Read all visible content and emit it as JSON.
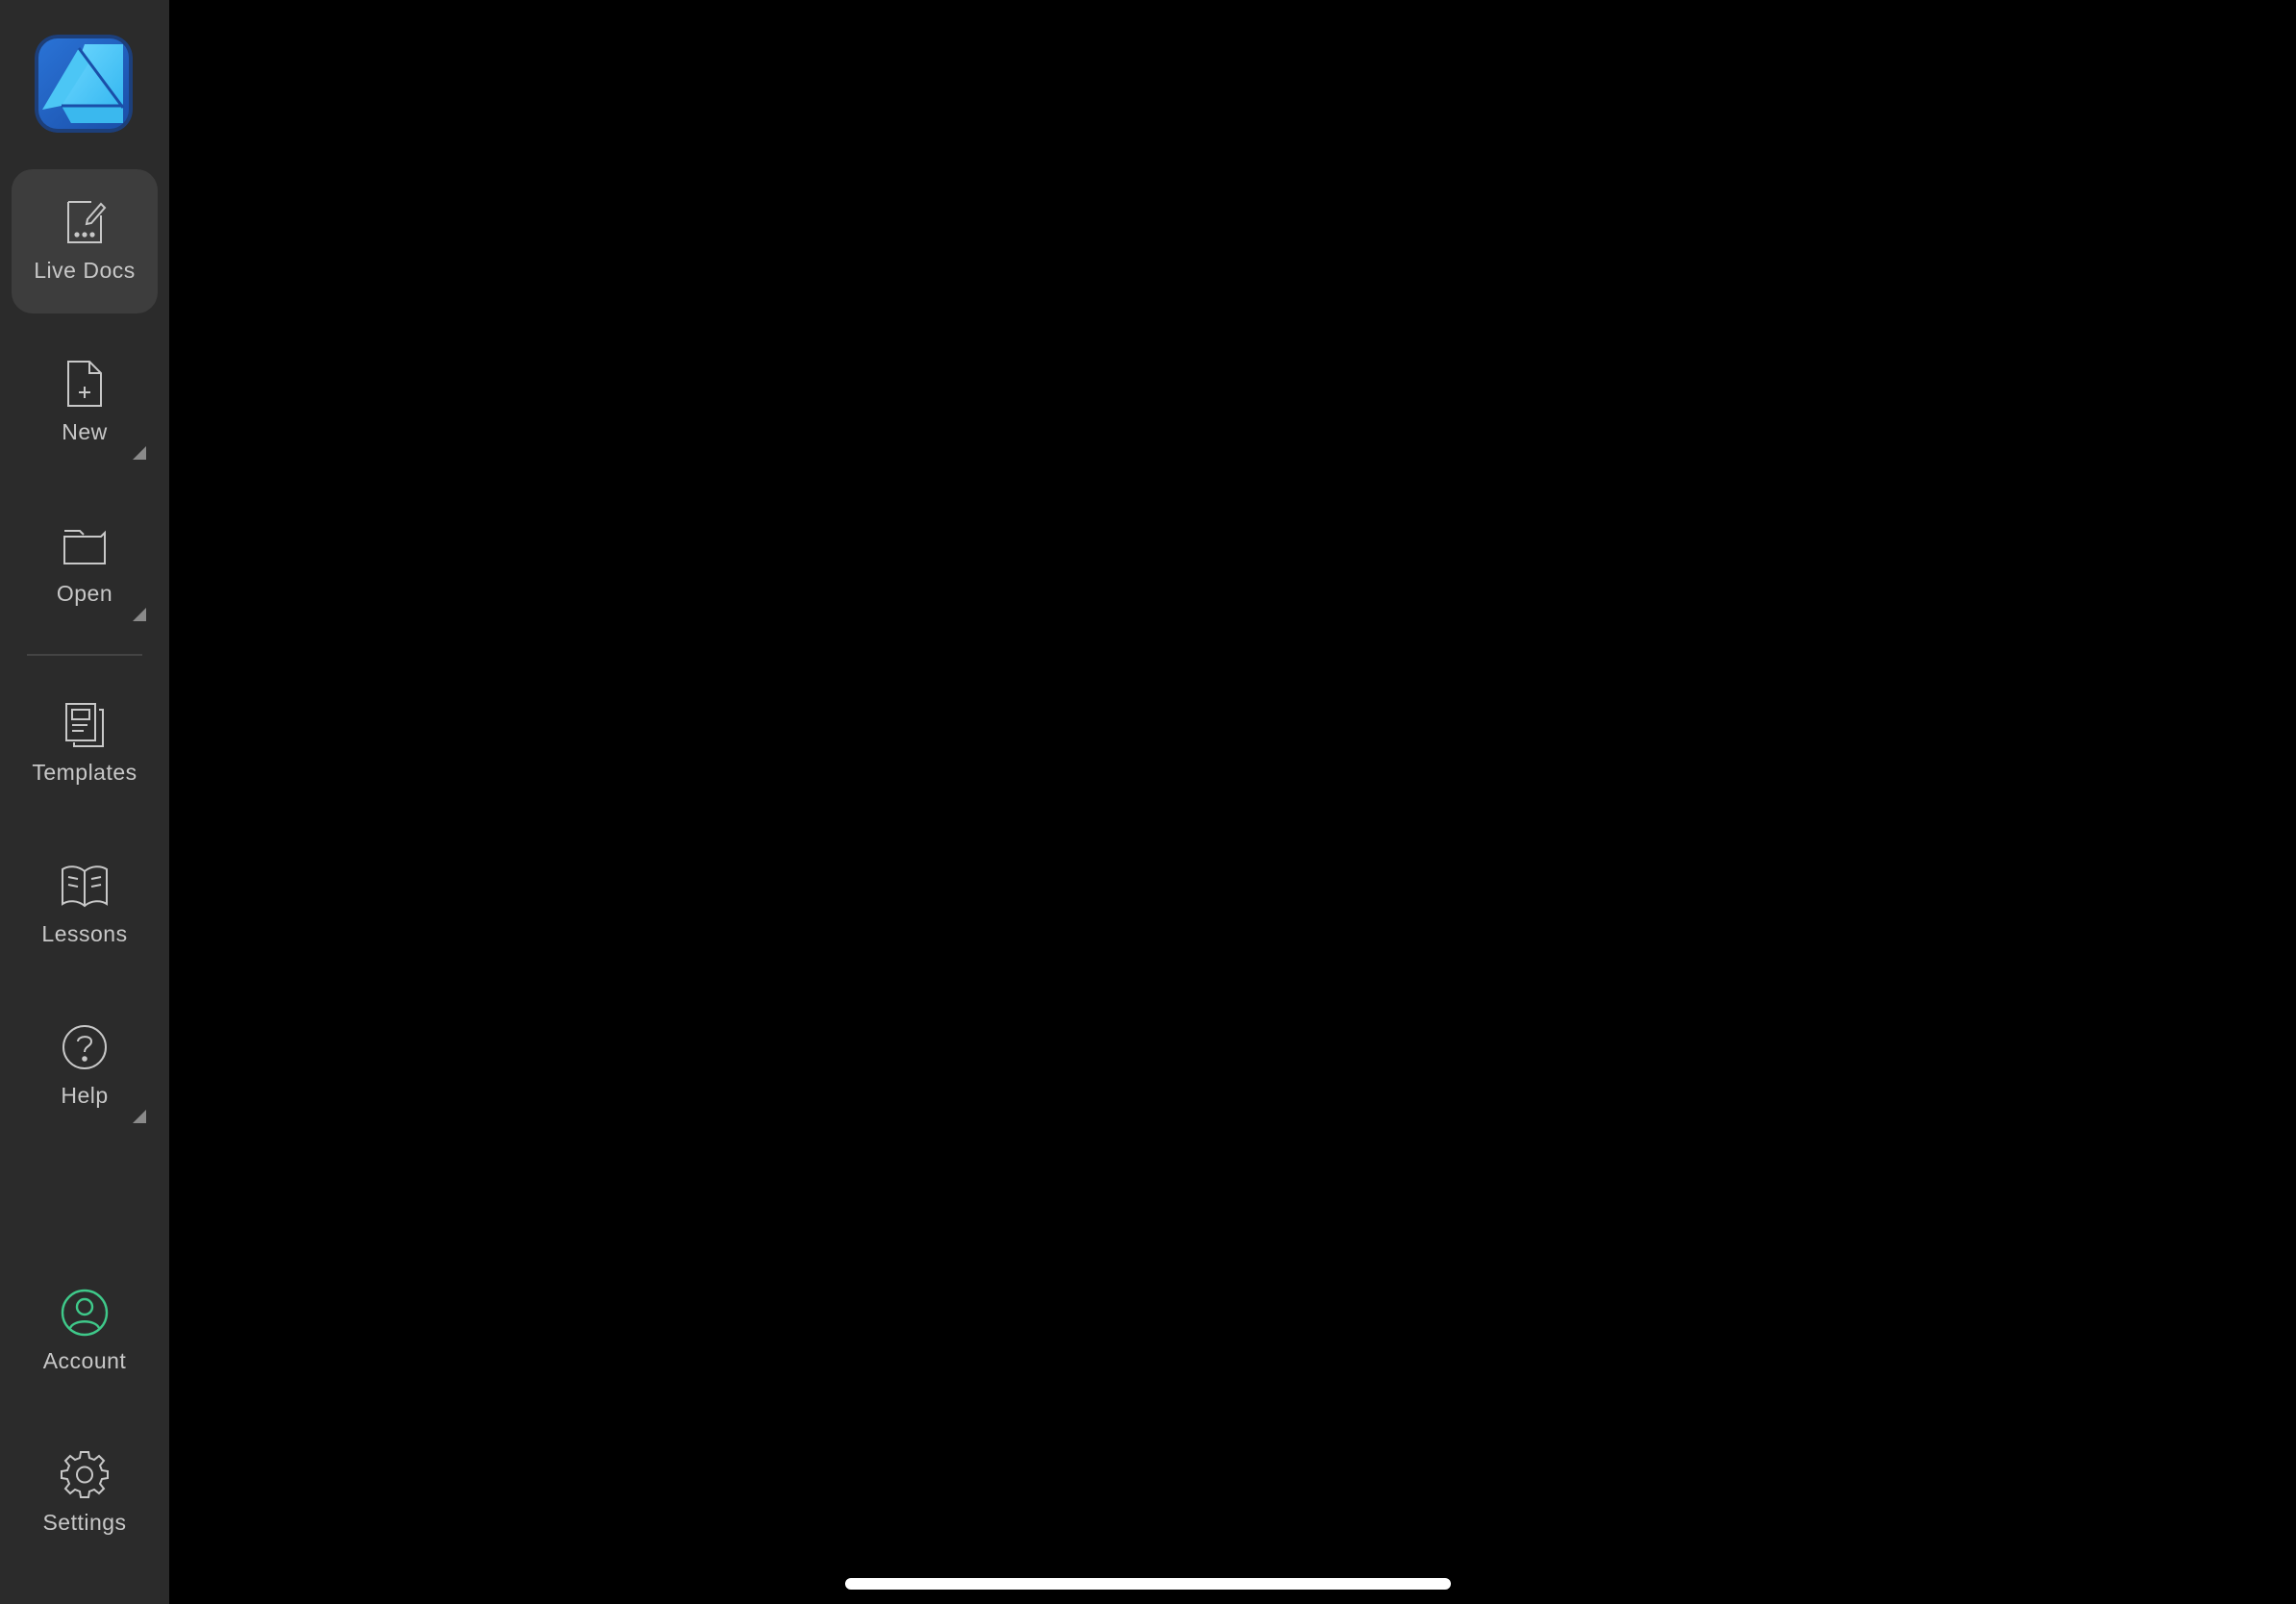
{
  "app": {
    "logo_icon": "affinity-designer-logo-icon",
    "accent_color": "#3fc98a",
    "sidebar_bg": "#2b2b2b",
    "canvas_bg": "#000000"
  },
  "sidebar": {
    "items": [
      {
        "id": "live-docs",
        "label": "Live Docs",
        "icon": "live-docs-icon",
        "active": true,
        "has_menu": false
      },
      {
        "id": "new",
        "label": "New",
        "icon": "new-document-icon",
        "active": false,
        "has_menu": true
      },
      {
        "id": "open",
        "label": "Open",
        "icon": "folder-icon",
        "active": false,
        "has_menu": true
      },
      {
        "id": "templates",
        "label": "Templates",
        "icon": "templates-icon",
        "active": false,
        "has_menu": false
      },
      {
        "id": "lessons",
        "label": "Lessons",
        "icon": "book-icon",
        "active": false,
        "has_menu": false
      },
      {
        "id": "help",
        "label": "Help",
        "icon": "question-circle-icon",
        "active": false,
        "has_menu": true
      },
      {
        "id": "account",
        "label": "Account",
        "icon": "user-circle-icon",
        "active": false,
        "has_menu": false
      },
      {
        "id": "settings",
        "label": "Settings",
        "icon": "gear-icon",
        "active": false,
        "has_menu": false
      }
    ]
  }
}
